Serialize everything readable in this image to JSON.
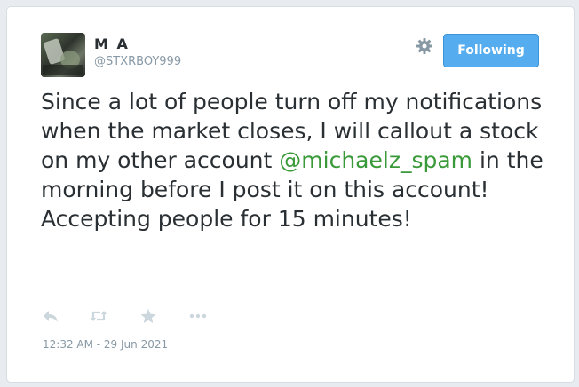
{
  "author": {
    "name": "M A",
    "handle": "@STXRBOY999"
  },
  "follow_button": {
    "label": "Following"
  },
  "tweet": {
    "text_before": "Since a lot of people turn off my notifications when the market closes, I will callout a stock on my other account ",
    "mention": "@michaelz_spam",
    "text_after": " in the morning before I post it on this account! Accepting people for 15 minutes!"
  },
  "timestamp": "12:32 AM - 29 Jun 2021",
  "icons": {
    "settings": "gear-icon",
    "reply": "reply-icon",
    "retweet": "retweet-icon",
    "favorite": "star-icon",
    "more": "more-icon"
  },
  "colors": {
    "button_bg": "#55acee",
    "mention": "#3a9a3a",
    "muted": "#8899a6",
    "text": "#292f33"
  }
}
